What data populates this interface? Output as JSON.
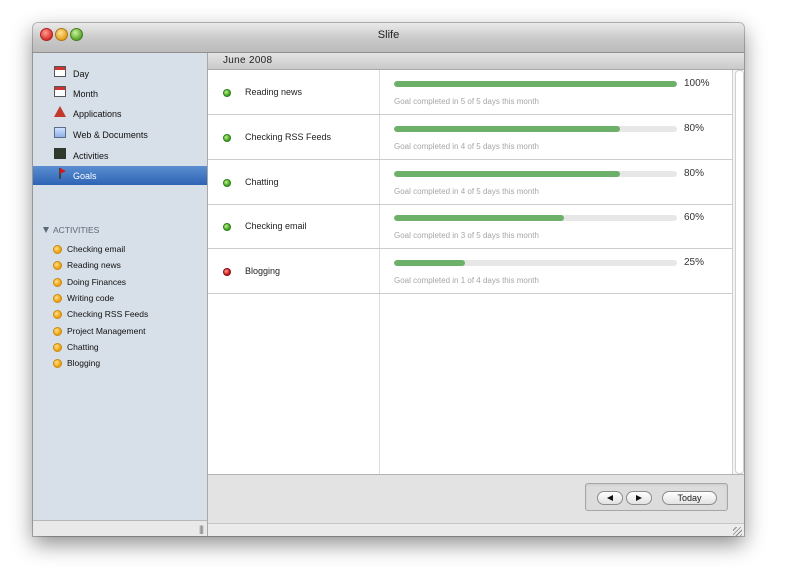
{
  "window": {
    "title": "Slife"
  },
  "sidebar": {
    "views": [
      {
        "label": "Day",
        "icon": "calendar-day-icon"
      },
      {
        "label": "Month",
        "icon": "calendar-month-icon"
      },
      {
        "label": "Applications",
        "icon": "applications-icon"
      },
      {
        "label": "Web & Documents",
        "icon": "web-documents-icon"
      },
      {
        "label": "Activities",
        "icon": "activities-icon"
      },
      {
        "label": "Goals",
        "icon": "goals-flag-icon",
        "selected": true
      }
    ],
    "section_title": "ACTIVITIES",
    "activities": [
      "Checking email",
      "Reading news",
      "Doing Finances",
      "Writing code",
      "Checking RSS Feeds",
      "Project Management",
      "Chatting",
      "Blogging"
    ],
    "grip": "|||"
  },
  "main": {
    "month_label": "June 2008",
    "goals": [
      {
        "name": "Reading news",
        "percent_label": "100%",
        "progress": 1.0,
        "detail": "Goal completed in 5 of 5 days this month",
        "status": "green"
      },
      {
        "name": "Checking RSS Feeds",
        "percent_label": "80%",
        "progress": 0.8,
        "detail": "Goal completed in 4 of 5 days this month",
        "status": "green"
      },
      {
        "name": "Chatting",
        "percent_label": "80%",
        "progress": 0.8,
        "detail": "Goal completed in 4 of 5 days this month",
        "status": "green"
      },
      {
        "name": "Checking email",
        "percent_label": "60%",
        "progress": 0.6,
        "detail": "Goal completed in 3 of 5 days this month",
        "status": "green"
      },
      {
        "name": "Blogging",
        "percent_label": "25%",
        "progress": 0.25,
        "detail": "Goal completed in 1 of 4 days this month",
        "status": "red"
      }
    ]
  },
  "footer": {
    "today_label": "Today"
  },
  "colors": {
    "progress_fill": "#6db06a",
    "selection": "#2d63b4",
    "status_green": "#3fa420",
    "status_red": "#c81414"
  }
}
